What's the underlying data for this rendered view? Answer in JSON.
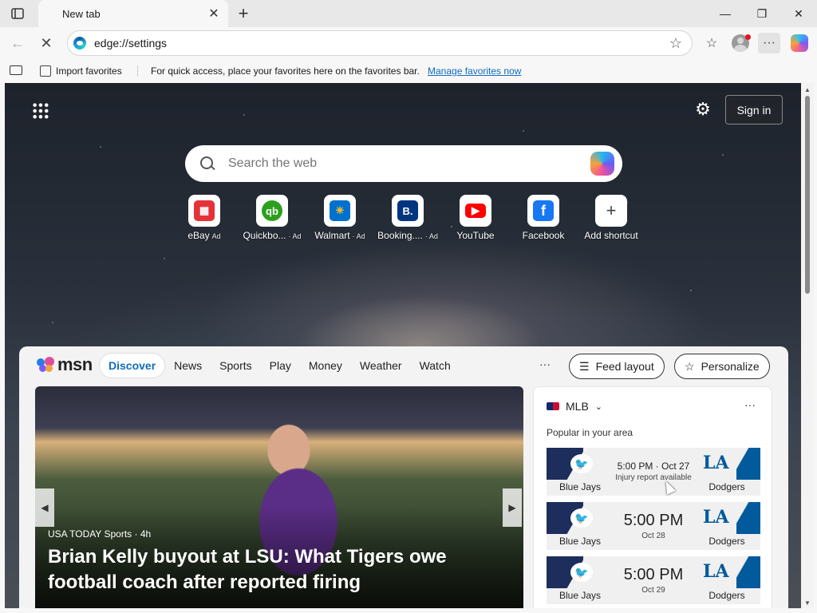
{
  "tab": {
    "title": "New tab"
  },
  "window": {
    "minimize": "—",
    "maximize": "❐",
    "close": "✕"
  },
  "address_bar": {
    "url": "edge://settings"
  },
  "favorites_bar": {
    "import_label": "Import favorites",
    "message": "For quick access, place your favorites here on the favorites bar.",
    "link": "Manage favorites now"
  },
  "newtab": {
    "signin_label": "Sign in",
    "search_placeholder": "Search the web",
    "shortcuts": [
      {
        "label": "eBay",
        "ad": "Ad",
        "icon": "ebay-icon",
        "color": "#e53238"
      },
      {
        "label": "Quickbo...",
        "ad": "· Ad",
        "icon": "quickbooks-icon",
        "color": "#2ca01c"
      },
      {
        "label": "Walmart",
        "ad": "· Ad",
        "icon": "walmart-icon",
        "color": "#0071ce"
      },
      {
        "label": "Booking....",
        "ad": "· Ad",
        "icon": "booking-icon",
        "color": "#003580"
      },
      {
        "label": "YouTube",
        "ad": "",
        "icon": "youtube-icon",
        "color": "#ff0000"
      },
      {
        "label": "Facebook",
        "ad": "",
        "icon": "facebook-icon",
        "color": "#1877f2"
      },
      {
        "label": "Add shortcut",
        "ad": "",
        "icon": "plus-icon",
        "color": "#444444"
      }
    ]
  },
  "msn": {
    "logo_text": "msn",
    "tabs": [
      "Discover",
      "News",
      "Sports",
      "Play",
      "Money",
      "Weather",
      "Watch"
    ],
    "more": "···",
    "feed_layout": "Feed layout",
    "personalize": "Personalize",
    "hero": {
      "source": "USA TODAY Sports · 4h",
      "headline": "Brian Kelly buyout at LSU: What Tigers owe football coach after reported firing"
    },
    "mlb": {
      "title": "MLB",
      "subtitle": "Popular in your area",
      "games": [
        {
          "home": "Blue Jays",
          "away": "Dodgers",
          "time": "5:00 PM · Oct 27",
          "note": "Injury report available"
        },
        {
          "home": "Blue Jays",
          "away": "Dodgers",
          "time": "5:00 PM",
          "note": "Oct 28"
        },
        {
          "home": "Blue Jays",
          "away": "Dodgers",
          "time": "5:00 PM",
          "note": "Oct 29"
        }
      ]
    }
  },
  "colors": {
    "accent": "#0f6cbd",
    "jays_navy": "#1d2d5c",
    "dodgers_blue": "#005a9c"
  }
}
